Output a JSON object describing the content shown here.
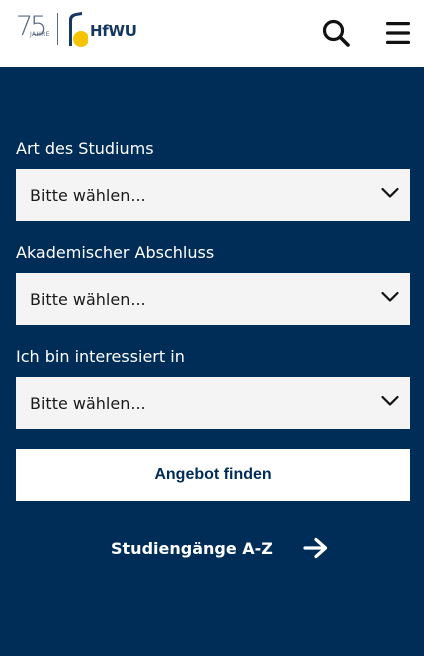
{
  "header": {
    "logo_anniversary_number": "75",
    "logo_anniversary_word": "JAHRE",
    "logo_brand": "HfWU",
    "icons": {
      "search": "search-icon",
      "menu": "hamburger-menu-icon"
    }
  },
  "colors": {
    "panel_background": "#002c58",
    "field_background": "#f4f4f4",
    "logo_accent_yellow": "#f5c400",
    "logo_navy": "#14385f"
  },
  "filters": [
    {
      "label": "Art des Studiums",
      "value": "Bitte wählen..."
    },
    {
      "label": "Akademischer Abschluss",
      "value": "Bitte wählen..."
    },
    {
      "label": "Ich bin interessiert in",
      "value": "Bitte wählen..."
    }
  ],
  "submit_label": "Angebot finden",
  "az_link": {
    "label": "Studiengänge A-Z",
    "icon": "arrow-right-icon"
  }
}
